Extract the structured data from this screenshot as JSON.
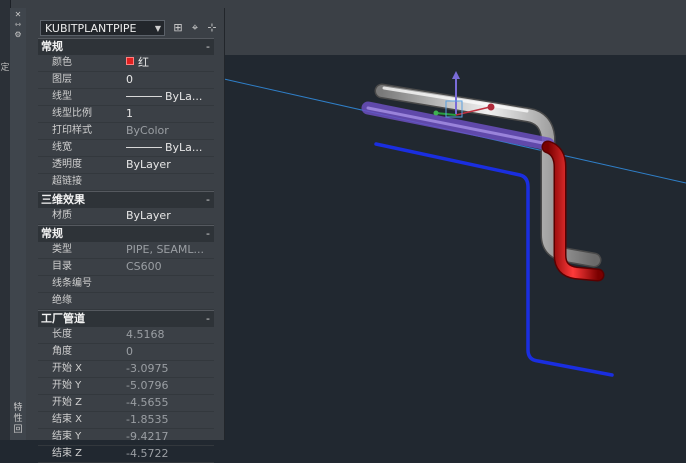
{
  "left_strip": {
    "text": "定"
  },
  "side_handle": {
    "vertical_title": "特性",
    "bottom_label": "回"
  },
  "palette": {
    "object_selector": "KUBITPLANTPIPE",
    "toolbar_icons": [
      "quick-select-icon",
      "select-objects-icon",
      "toggle-pickadd-icon"
    ],
    "sections": [
      {
        "title": "常规",
        "rows": [
          {
            "key": "颜色",
            "value": "红",
            "swatch": "#e02020"
          },
          {
            "key": "图层",
            "value": "0"
          },
          {
            "key": "线型",
            "value": "ByLa...",
            "line": true
          },
          {
            "key": "线型比例",
            "value": "1"
          },
          {
            "key": "打印样式",
            "value": "ByColor",
            "dim": true
          },
          {
            "key": "线宽",
            "value": "ByLa...",
            "line": true
          },
          {
            "key": "透明度",
            "value": "ByLayer"
          },
          {
            "key": "超链接",
            "value": ""
          }
        ]
      },
      {
        "title": "三维效果",
        "rows": [
          {
            "key": "材质",
            "value": "ByLayer"
          }
        ]
      },
      {
        "title": "常规",
        "rows": [
          {
            "key": "类型",
            "value": "PIPE, SEAML...",
            "dim": true
          },
          {
            "key": "目录",
            "value": "CS600",
            "dim": true
          },
          {
            "key": "线条编号",
            "value": ""
          },
          {
            "key": "绝缘",
            "value": ""
          }
        ]
      },
      {
        "title": "工厂管道",
        "rows": [
          {
            "key": "长度",
            "value": "4.5168",
            "dim": true
          },
          {
            "key": "角度",
            "value": "0",
            "dim": true
          },
          {
            "key": "开始 X",
            "value": "-3.0975",
            "dim": true
          },
          {
            "key": "开始 Y",
            "value": "-5.0796",
            "dim": true
          },
          {
            "key": "开始 Z",
            "value": "-4.5655",
            "dim": true
          },
          {
            "key": "结束 X",
            "value": "-1.8535",
            "dim": true
          },
          {
            "key": "结束 Y",
            "value": "-9.4217",
            "dim": true
          },
          {
            "key": "结束 Z",
            "value": "-4.5722",
            "dim": true
          }
        ]
      }
    ],
    "collapse_symbol": "-"
  },
  "colors": {
    "viewport_bg": "#212830",
    "selected_pipe": "#cc1010",
    "grey_pipe": "#c9c9c9",
    "blue_line": "#1a2ee0",
    "highlight_pipe": "#7b5cc8",
    "ucs_axis_line": "#2f7fc8"
  }
}
